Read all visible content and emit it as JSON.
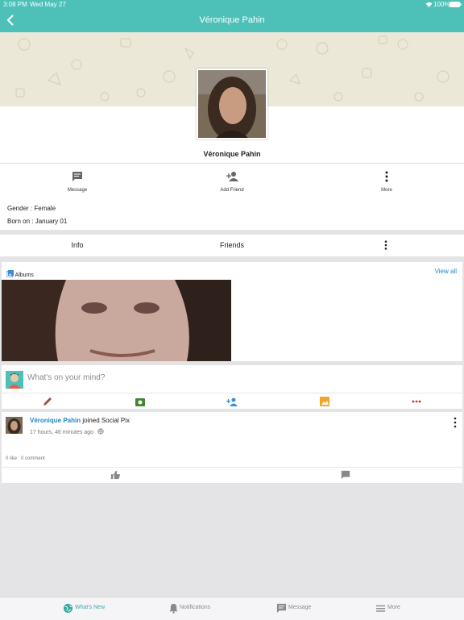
{
  "status_bar": {
    "time": "3:08 PM",
    "date": "Wed May 27",
    "battery": "100%"
  },
  "header": {
    "title": "Véronique Pahin",
    "back_icon": "chevron-left-icon"
  },
  "profile": {
    "name": "Véronique Pahin"
  },
  "actions": [
    {
      "label": "Message",
      "icon": "chat-icon"
    },
    {
      "label": "Add Friend",
      "icon": "add-person-icon"
    },
    {
      "label": "More",
      "icon": "kebab-icon"
    }
  ],
  "about": {
    "gender": "Gender : Female",
    "born": "Born on : January 01"
  },
  "tabs": {
    "info": "Info",
    "friends": "Friends"
  },
  "albums": {
    "title": "Albums",
    "view_all": "View all"
  },
  "composer": {
    "placeholder": "What's on your mind?"
  },
  "post": {
    "author": "Véronique Pahin",
    "action": " joined Social Pix",
    "time": "17 hours, 46 minutes ago",
    "likes": "0 like",
    "comments": "0 comment"
  },
  "bottom_nav": {
    "whats_new": "What's New",
    "notifications": "Notifications",
    "message": "Message",
    "more": "More"
  },
  "colors": {
    "accent": "#4dc0b8",
    "link": "#1f86c4",
    "cover": "#ebe8d8"
  }
}
